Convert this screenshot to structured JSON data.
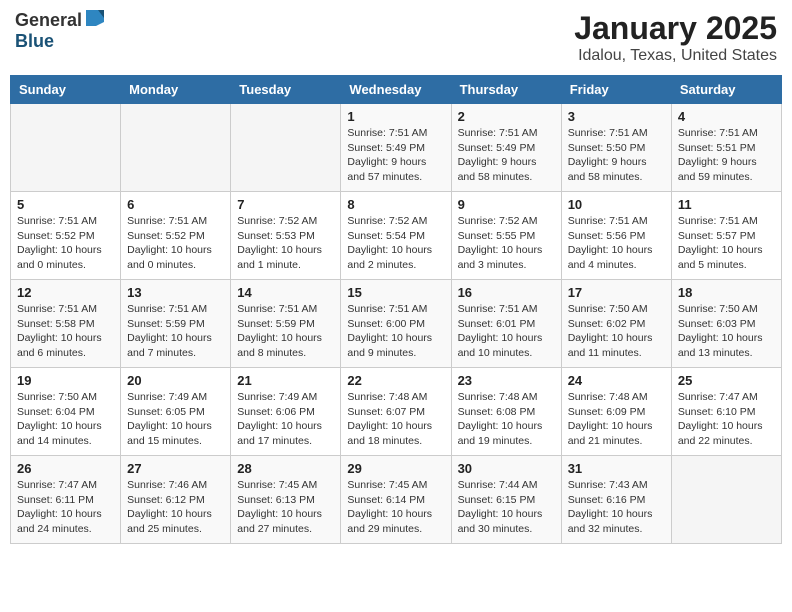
{
  "header": {
    "logo_general": "General",
    "logo_blue": "Blue",
    "month": "January 2025",
    "location": "Idalou, Texas, United States"
  },
  "weekdays": [
    "Sunday",
    "Monday",
    "Tuesday",
    "Wednesday",
    "Thursday",
    "Friday",
    "Saturday"
  ],
  "weeks": [
    [
      {
        "num": "",
        "info": ""
      },
      {
        "num": "",
        "info": ""
      },
      {
        "num": "",
        "info": ""
      },
      {
        "num": "1",
        "info": "Sunrise: 7:51 AM\nSunset: 5:49 PM\nDaylight: 9 hours\nand 57 minutes."
      },
      {
        "num": "2",
        "info": "Sunrise: 7:51 AM\nSunset: 5:49 PM\nDaylight: 9 hours\nand 58 minutes."
      },
      {
        "num": "3",
        "info": "Sunrise: 7:51 AM\nSunset: 5:50 PM\nDaylight: 9 hours\nand 58 minutes."
      },
      {
        "num": "4",
        "info": "Sunrise: 7:51 AM\nSunset: 5:51 PM\nDaylight: 9 hours\nand 59 minutes."
      }
    ],
    [
      {
        "num": "5",
        "info": "Sunrise: 7:51 AM\nSunset: 5:52 PM\nDaylight: 10 hours\nand 0 minutes."
      },
      {
        "num": "6",
        "info": "Sunrise: 7:51 AM\nSunset: 5:52 PM\nDaylight: 10 hours\nand 0 minutes."
      },
      {
        "num": "7",
        "info": "Sunrise: 7:52 AM\nSunset: 5:53 PM\nDaylight: 10 hours\nand 1 minute."
      },
      {
        "num": "8",
        "info": "Sunrise: 7:52 AM\nSunset: 5:54 PM\nDaylight: 10 hours\nand 2 minutes."
      },
      {
        "num": "9",
        "info": "Sunrise: 7:52 AM\nSunset: 5:55 PM\nDaylight: 10 hours\nand 3 minutes."
      },
      {
        "num": "10",
        "info": "Sunrise: 7:51 AM\nSunset: 5:56 PM\nDaylight: 10 hours\nand 4 minutes."
      },
      {
        "num": "11",
        "info": "Sunrise: 7:51 AM\nSunset: 5:57 PM\nDaylight: 10 hours\nand 5 minutes."
      }
    ],
    [
      {
        "num": "12",
        "info": "Sunrise: 7:51 AM\nSunset: 5:58 PM\nDaylight: 10 hours\nand 6 minutes."
      },
      {
        "num": "13",
        "info": "Sunrise: 7:51 AM\nSunset: 5:59 PM\nDaylight: 10 hours\nand 7 minutes."
      },
      {
        "num": "14",
        "info": "Sunrise: 7:51 AM\nSunset: 5:59 PM\nDaylight: 10 hours\nand 8 minutes."
      },
      {
        "num": "15",
        "info": "Sunrise: 7:51 AM\nSunset: 6:00 PM\nDaylight: 10 hours\nand 9 minutes."
      },
      {
        "num": "16",
        "info": "Sunrise: 7:51 AM\nSunset: 6:01 PM\nDaylight: 10 hours\nand 10 minutes."
      },
      {
        "num": "17",
        "info": "Sunrise: 7:50 AM\nSunset: 6:02 PM\nDaylight: 10 hours\nand 11 minutes."
      },
      {
        "num": "18",
        "info": "Sunrise: 7:50 AM\nSunset: 6:03 PM\nDaylight: 10 hours\nand 13 minutes."
      }
    ],
    [
      {
        "num": "19",
        "info": "Sunrise: 7:50 AM\nSunset: 6:04 PM\nDaylight: 10 hours\nand 14 minutes."
      },
      {
        "num": "20",
        "info": "Sunrise: 7:49 AM\nSunset: 6:05 PM\nDaylight: 10 hours\nand 15 minutes."
      },
      {
        "num": "21",
        "info": "Sunrise: 7:49 AM\nSunset: 6:06 PM\nDaylight: 10 hours\nand 17 minutes."
      },
      {
        "num": "22",
        "info": "Sunrise: 7:48 AM\nSunset: 6:07 PM\nDaylight: 10 hours\nand 18 minutes."
      },
      {
        "num": "23",
        "info": "Sunrise: 7:48 AM\nSunset: 6:08 PM\nDaylight: 10 hours\nand 19 minutes."
      },
      {
        "num": "24",
        "info": "Sunrise: 7:48 AM\nSunset: 6:09 PM\nDaylight: 10 hours\nand 21 minutes."
      },
      {
        "num": "25",
        "info": "Sunrise: 7:47 AM\nSunset: 6:10 PM\nDaylight: 10 hours\nand 22 minutes."
      }
    ],
    [
      {
        "num": "26",
        "info": "Sunrise: 7:47 AM\nSunset: 6:11 PM\nDaylight: 10 hours\nand 24 minutes."
      },
      {
        "num": "27",
        "info": "Sunrise: 7:46 AM\nSunset: 6:12 PM\nDaylight: 10 hours\nand 25 minutes."
      },
      {
        "num": "28",
        "info": "Sunrise: 7:45 AM\nSunset: 6:13 PM\nDaylight: 10 hours\nand 27 minutes."
      },
      {
        "num": "29",
        "info": "Sunrise: 7:45 AM\nSunset: 6:14 PM\nDaylight: 10 hours\nand 29 minutes."
      },
      {
        "num": "30",
        "info": "Sunrise: 7:44 AM\nSunset: 6:15 PM\nDaylight: 10 hours\nand 30 minutes."
      },
      {
        "num": "31",
        "info": "Sunrise: 7:43 AM\nSunset: 6:16 PM\nDaylight: 10 hours\nand 32 minutes."
      },
      {
        "num": "",
        "info": ""
      }
    ]
  ]
}
